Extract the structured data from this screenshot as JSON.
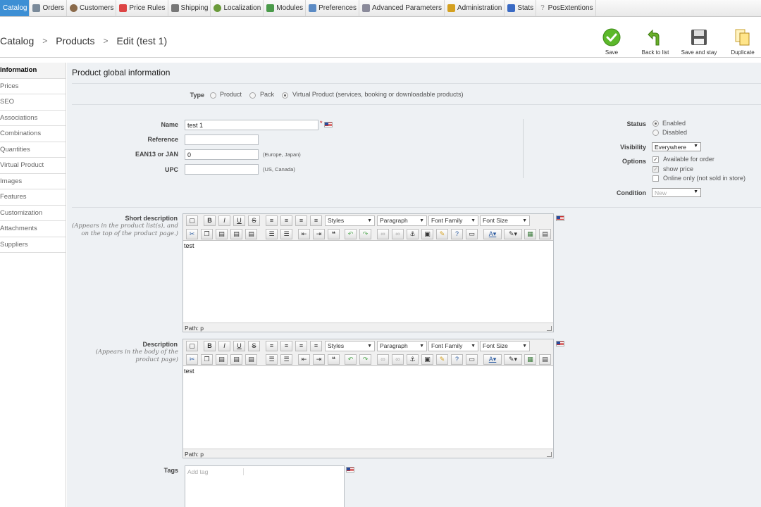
{
  "nav": [
    {
      "label": "Catalog",
      "icon": "catalog-icon",
      "active": true
    },
    {
      "label": "Orders",
      "icon": "cart-icon"
    },
    {
      "label": "Customers",
      "icon": "customers-icon"
    },
    {
      "label": "Price Rules",
      "icon": "price-rules-icon"
    },
    {
      "label": "Shipping",
      "icon": "truck-icon"
    },
    {
      "label": "Localization",
      "icon": "globe-icon"
    },
    {
      "label": "Modules",
      "icon": "puzzle-icon"
    },
    {
      "label": "Preferences",
      "icon": "preferences-icon"
    },
    {
      "label": "Advanced Parameters",
      "icon": "wrench-icon"
    },
    {
      "label": "Administration",
      "icon": "key-icon"
    },
    {
      "label": "Stats",
      "icon": "stats-icon"
    },
    {
      "label": "PosExtentions",
      "icon": "question-icon"
    }
  ],
  "breadcrumb": [
    "Catalog",
    "Products",
    "Edit (test 1)"
  ],
  "toolbar": {
    "save": "Save",
    "back": "Back to list",
    "save_stay": "Save and stay",
    "duplicate": "Duplicate"
  },
  "sidebar": [
    "Information",
    "Prices",
    "SEO",
    "Associations",
    "Combinations",
    "Quantities",
    "Virtual Product",
    "Images",
    "Features",
    "Customization",
    "Attachments",
    "Suppliers"
  ],
  "section_title": "Product global information",
  "type": {
    "label": "Type",
    "options": [
      "Product",
      "Pack",
      "Virtual Product (services, booking or downloadable products)"
    ]
  },
  "fields": {
    "name_label": "Name",
    "name_value": "test 1",
    "required_mark": "*",
    "reference_label": "Reference",
    "reference_value": "",
    "ean_label": "EAN13 or JAN",
    "ean_value": "0",
    "ean_hint": "(Europe, Japan)",
    "upc_label": "UPC",
    "upc_value": "",
    "upc_hint": "(US, Canada)"
  },
  "status": {
    "label": "Status",
    "enabled": "Enabled",
    "disabled": "Disabled",
    "visibility_label": "Visibility",
    "visibility_value": "Everywhere",
    "options_label": "Options",
    "available": "Available for order",
    "show_price": "show price",
    "online_only": "Online only (not sold in store)",
    "condition_label": "Condition",
    "condition_value": "New"
  },
  "editor_common": {
    "styles": "Styles",
    "paragraph": "Paragraph",
    "font_family": "Font Family",
    "font_size": "Font Size",
    "path": "Path: p"
  },
  "short_desc": {
    "label": "Short description",
    "note": "(Appears in the product list(s), and on the top of the product page.)",
    "content": "test"
  },
  "description": {
    "label": "Description",
    "note": "(Appears in the body of the product page)",
    "content": "test"
  },
  "tags": {
    "label": "Tags",
    "placeholder": "Add tag"
  }
}
